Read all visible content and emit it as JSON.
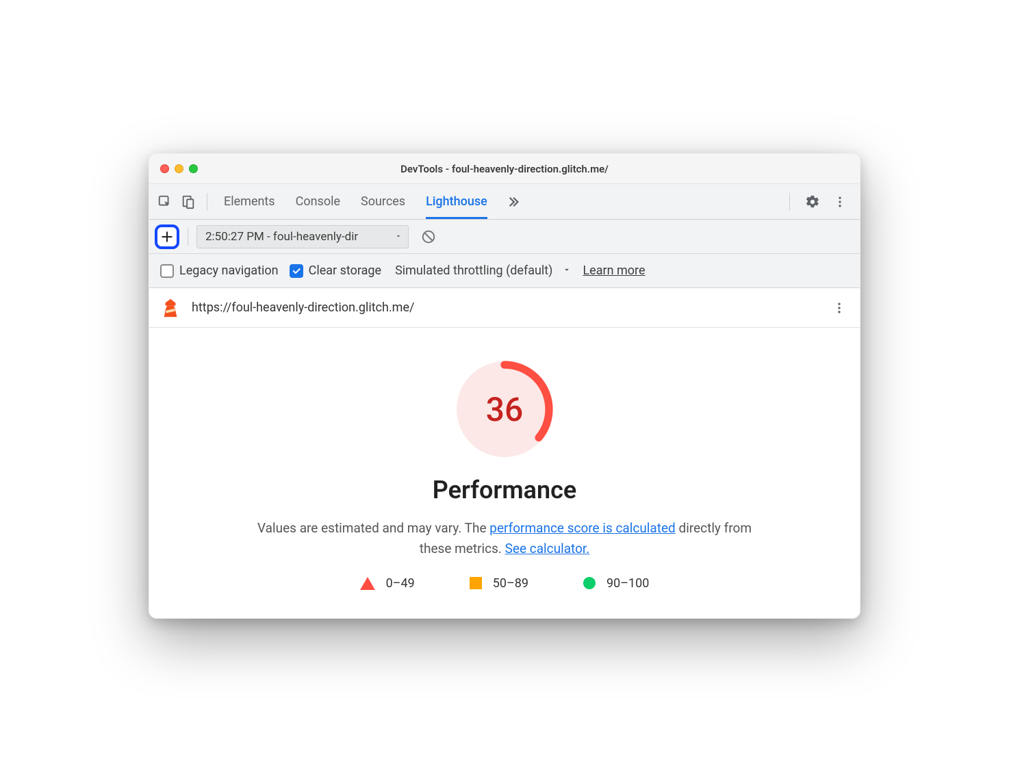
{
  "window": {
    "title": "DevTools - foul-heavenly-direction.glitch.me/"
  },
  "toolbar": {
    "tabs": [
      "Elements",
      "Console",
      "Sources",
      "Lighthouse"
    ],
    "active_tab": "Lighthouse"
  },
  "subtoolbar": {
    "report_label": "2:50:27 PM - foul-heavenly-dir"
  },
  "options": {
    "legacy_label": "Legacy navigation",
    "legacy_checked": false,
    "clear_storage_label": "Clear storage",
    "clear_storage_checked": true,
    "throttling_label": "Simulated throttling (default)",
    "learn_more": "Learn more"
  },
  "urlbar": {
    "url": "https://foul-heavenly-direction.glitch.me/"
  },
  "report": {
    "score": 36,
    "title": "Performance",
    "desc_prefix": "Values are estimated and may vary. The ",
    "link1": "performance score is calculated",
    "desc_mid": " directly from these metrics. ",
    "link2": "See calculator.",
    "legend": {
      "fail": "0–49",
      "avg": "50–89",
      "pass": "90–100"
    },
    "gauge": {
      "percent": 36,
      "color_arc": "#ff4e42",
      "color_bg": "#fce8e6",
      "color_text": "#c5221f"
    }
  },
  "chart_data": {
    "type": "gauge",
    "title": "Performance",
    "value": 36,
    "range": [
      0,
      100
    ],
    "bands": [
      {
        "label": "0–49",
        "min": 0,
        "max": 49,
        "color": "#ff4e42"
      },
      {
        "label": "50–89",
        "min": 50,
        "max": 89,
        "color": "#ffa400"
      },
      {
        "label": "90–100",
        "min": 90,
        "max": 100,
        "color": "#0cce6b"
      }
    ]
  }
}
